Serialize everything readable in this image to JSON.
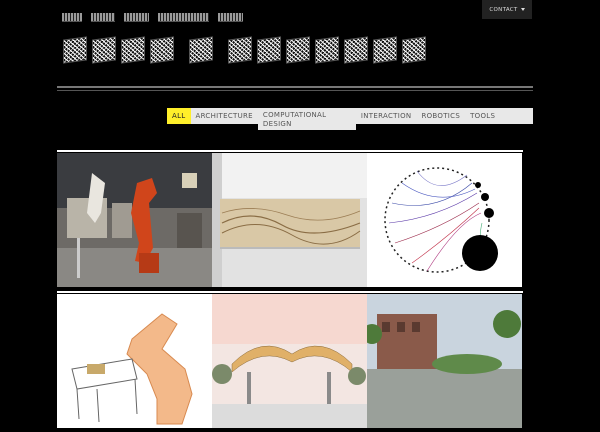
{
  "header": {
    "nav_items": [
      "home-link",
      "about-link",
      "news-link",
      "workshops-link",
      "team-link"
    ],
    "contact_label": "CONTACT"
  },
  "filters": {
    "items": [
      {
        "label": "ALL",
        "active": true
      },
      {
        "label": "ARCHITECTURE",
        "active": false
      },
      {
        "label": "COMPUTATIONAL DESIGN",
        "active": false
      },
      {
        "label": "INTERACTION",
        "active": false
      },
      {
        "label": "ROBOTICS",
        "active": false
      },
      {
        "label": "TOOLS",
        "active": false
      }
    ]
  },
  "gallery": {
    "tiles": [
      {
        "name": "robot-lab-photo"
      },
      {
        "name": "wave-wall-render"
      },
      {
        "name": "network-circle-diagram"
      },
      {
        "name": "robot-arm-sketch"
      },
      {
        "name": "canopy-pavilion-render"
      },
      {
        "name": "plaza-building-render"
      }
    ]
  },
  "colors": {
    "accent": "#ffef2a",
    "background": "#000000",
    "filter_bar": "#e8e8e8"
  }
}
